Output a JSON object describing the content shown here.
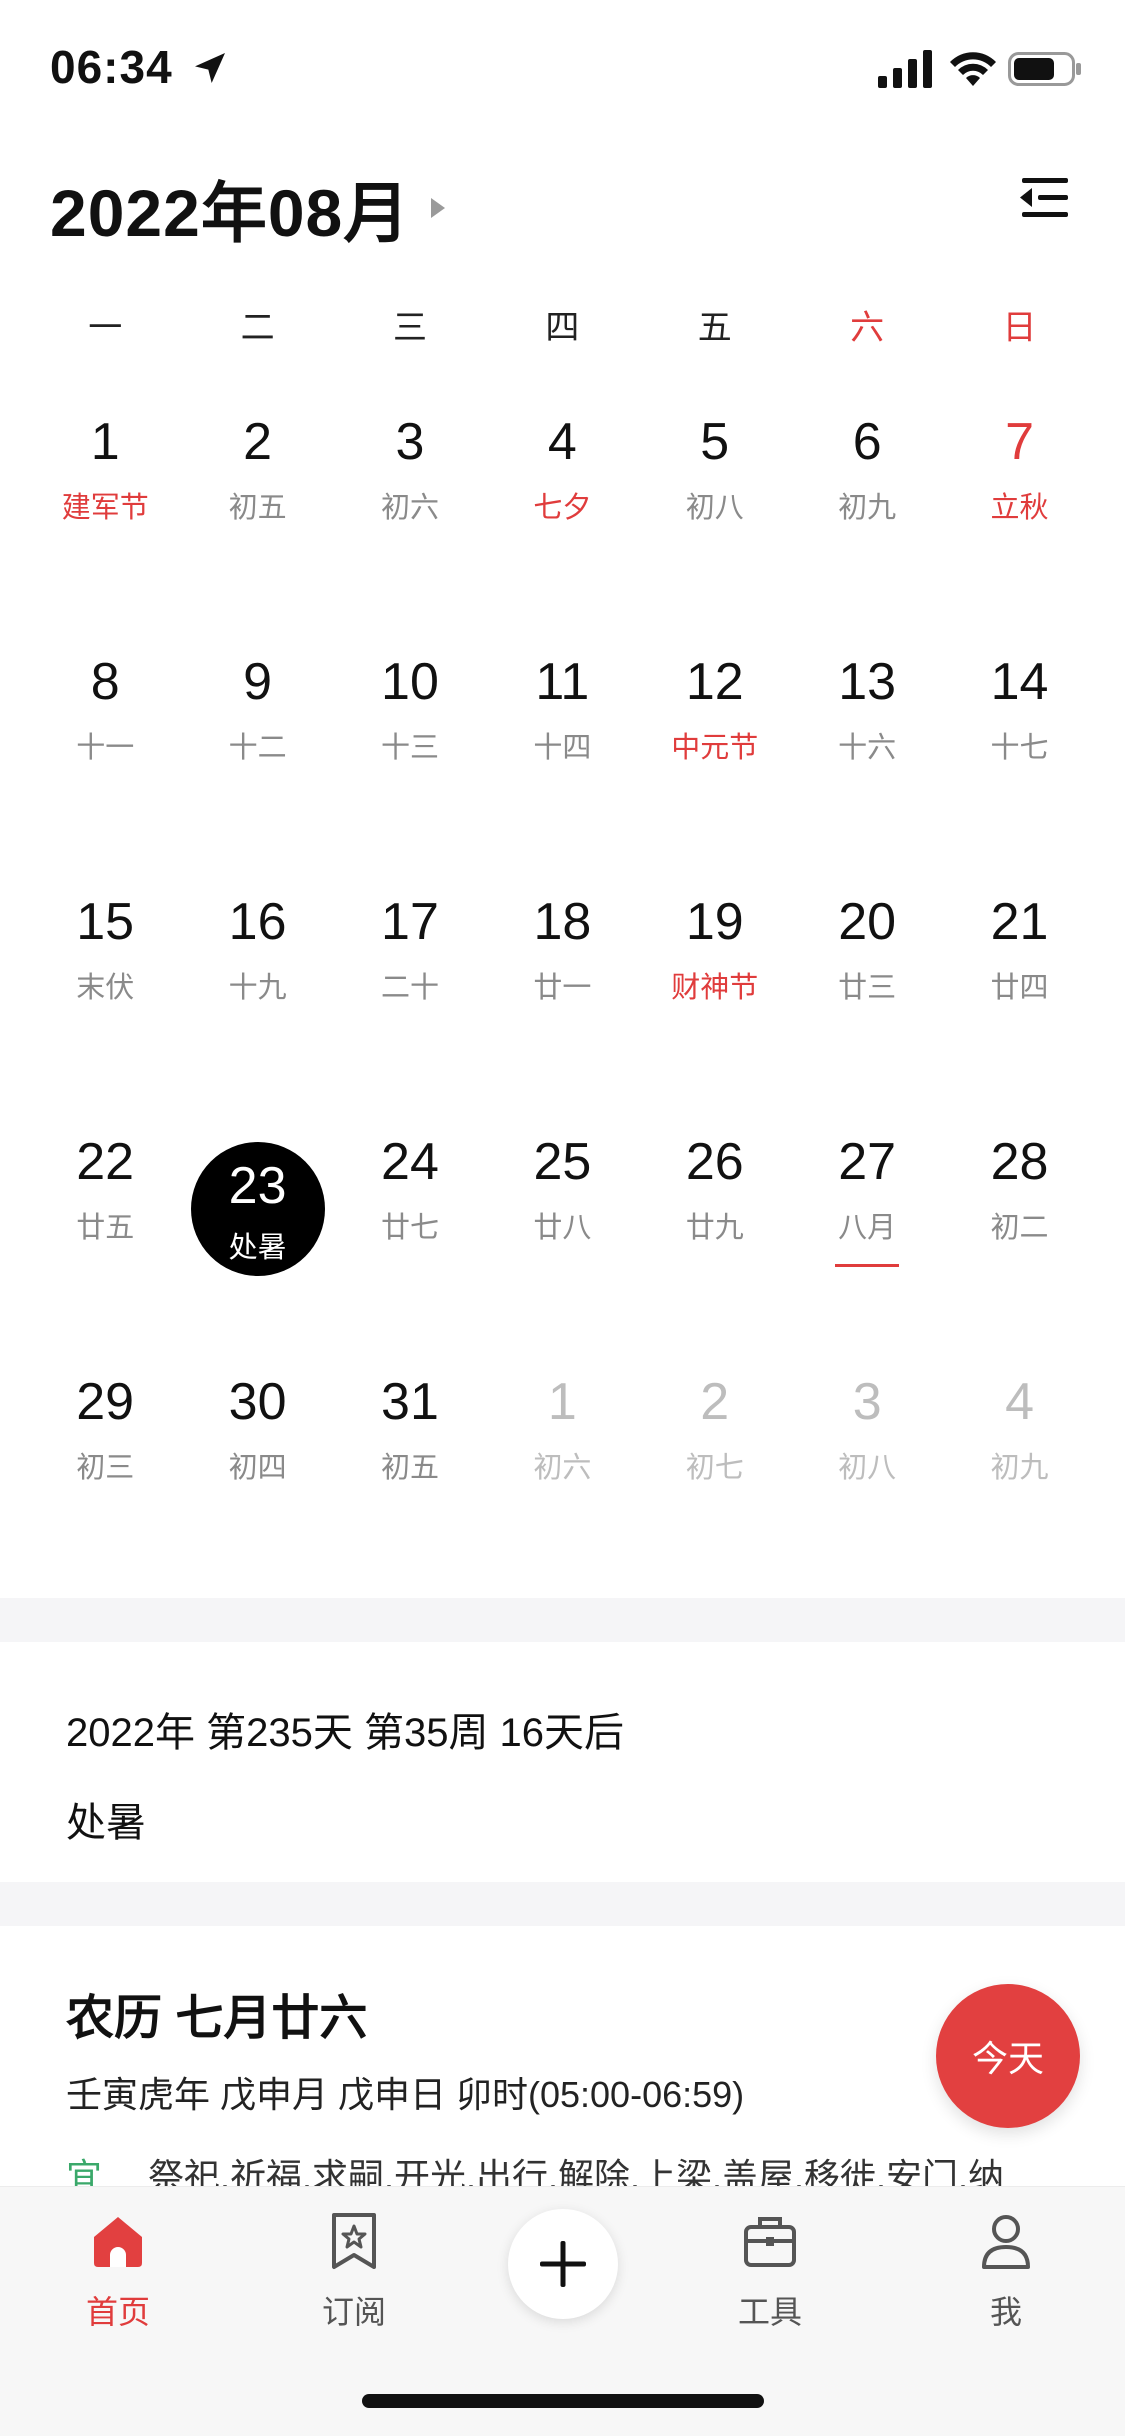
{
  "status_bar": {
    "time": "06:34"
  },
  "header": {
    "title": "2022年08月"
  },
  "weekdays": [
    "一",
    "二",
    "三",
    "四",
    "五",
    "六",
    "日"
  ],
  "calendar": {
    "weeks": [
      [
        {
          "day": "1",
          "lunar": "建军节",
          "lunar_red": true
        },
        {
          "day": "2",
          "lunar": "初五"
        },
        {
          "day": "3",
          "lunar": "初六"
        },
        {
          "day": "4",
          "lunar": "七夕",
          "lunar_red": true
        },
        {
          "day": "5",
          "lunar": "初八"
        },
        {
          "day": "6",
          "lunar": "初九"
        },
        {
          "day": "7",
          "lunar": "立秋",
          "lunar_red": true,
          "day_red": true
        }
      ],
      [
        {
          "day": "8",
          "lunar": "十一"
        },
        {
          "day": "9",
          "lunar": "十二"
        },
        {
          "day": "10",
          "lunar": "十三"
        },
        {
          "day": "11",
          "lunar": "十四"
        },
        {
          "day": "12",
          "lunar": "中元节",
          "lunar_red": true
        },
        {
          "day": "13",
          "lunar": "十六"
        },
        {
          "day": "14",
          "lunar": "十七"
        }
      ],
      [
        {
          "day": "15",
          "lunar": "末伏"
        },
        {
          "day": "16",
          "lunar": "十九"
        },
        {
          "day": "17",
          "lunar": "二十"
        },
        {
          "day": "18",
          "lunar": "廿一"
        },
        {
          "day": "19",
          "lunar": "财神节",
          "lunar_red": true
        },
        {
          "day": "20",
          "lunar": "廿三"
        },
        {
          "day": "21",
          "lunar": "廿四"
        }
      ],
      [
        {
          "day": "22",
          "lunar": "廿五"
        },
        {
          "day": "23",
          "lunar": "处暑",
          "selected": true
        },
        {
          "day": "24",
          "lunar": "廿七"
        },
        {
          "day": "25",
          "lunar": "廿八"
        },
        {
          "day": "26",
          "lunar": "廿九"
        },
        {
          "day": "27",
          "lunar": "八月",
          "today": true
        },
        {
          "day": "28",
          "lunar": "初二"
        }
      ],
      [
        {
          "day": "29",
          "lunar": "初三"
        },
        {
          "day": "30",
          "lunar": "初四"
        },
        {
          "day": "31",
          "lunar": "初五"
        },
        {
          "day": "1",
          "lunar": "初六",
          "other_month": true
        },
        {
          "day": "2",
          "lunar": "初七",
          "other_month": true
        },
        {
          "day": "3",
          "lunar": "初八",
          "other_month": true
        },
        {
          "day": "4",
          "lunar": "初九",
          "other_month": true
        }
      ]
    ]
  },
  "info": {
    "line1": "2022年 第235天 第35周 16天后",
    "line2": "处暑"
  },
  "lunar_detail": {
    "title": "农历 七月廿六",
    "ganzhi": "壬寅虎年 戊申月 戊申日 卯时(05:00-06:59)",
    "yi_label": "宜",
    "yi_text": "祭祀.祈福.求嗣.开光.出行.解除.上梁.盖屋.移徙.安门.纳"
  },
  "today_button": "今天",
  "tabbar": {
    "home": "首页",
    "subscribe": "订阅",
    "tools": "工具",
    "me": "我"
  },
  "colors": {
    "accent_red": "#e03c3c",
    "green": "#3aa86a",
    "selected_bg": "#000000"
  }
}
